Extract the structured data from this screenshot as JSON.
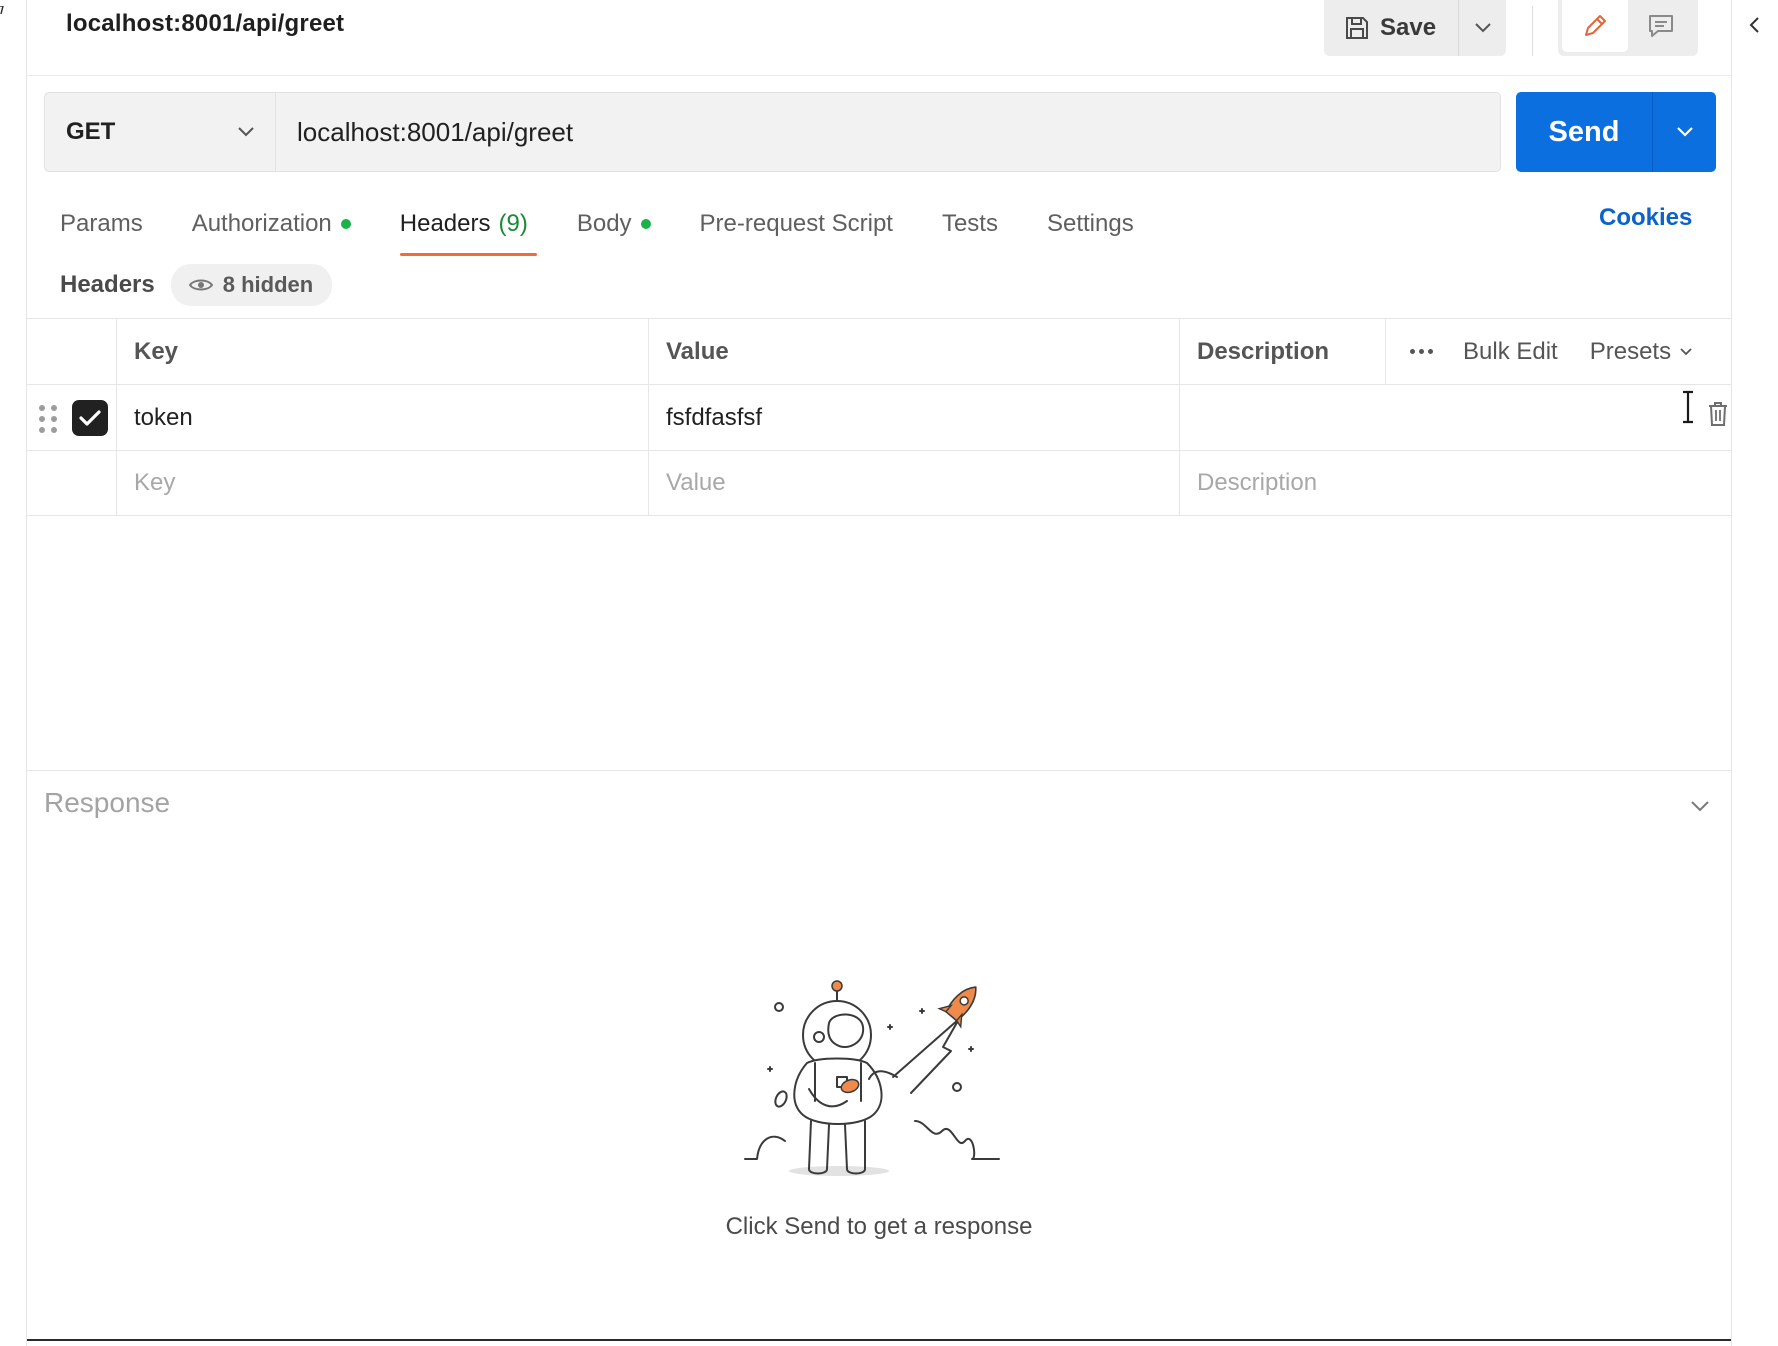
{
  "request_title": "localhost:8001/api/greet",
  "toolbar": {
    "save_label": "Save"
  },
  "request": {
    "method": "GET",
    "url": "localhost:8001/api/greet",
    "send_label": "Send"
  },
  "tabs": [
    {
      "label": "Params"
    },
    {
      "label": "Authorization",
      "dot": true
    },
    {
      "label": "Headers",
      "count": "(9)",
      "active": true
    },
    {
      "label": "Body",
      "dot": true
    },
    {
      "label": "Pre-request Script"
    },
    {
      "label": "Tests"
    },
    {
      "label": "Settings"
    }
  ],
  "cookies_label": "Cookies",
  "headers_section": {
    "label": "Headers",
    "hidden_label": "8 hidden"
  },
  "table": {
    "columns": {
      "key": "Key",
      "value": "Value",
      "description": "Description"
    },
    "bulk_edit_label": "Bulk Edit",
    "presets_label": "Presets",
    "rows": [
      {
        "key": "token",
        "value": "fsfdfasfsf",
        "checked": true
      }
    ],
    "placeholders": {
      "key": "Key",
      "value": "Value",
      "description": "Description"
    }
  },
  "response": {
    "title": "Response",
    "empty_text": "Click Send to get a response"
  },
  "colors": {
    "send": "#0b6fe0",
    "active_tab_underline": "#f26b3a",
    "status_dot": "#19b34a",
    "cookies_link": "#0b62c9",
    "illustration_accent": "#f08a4b"
  }
}
